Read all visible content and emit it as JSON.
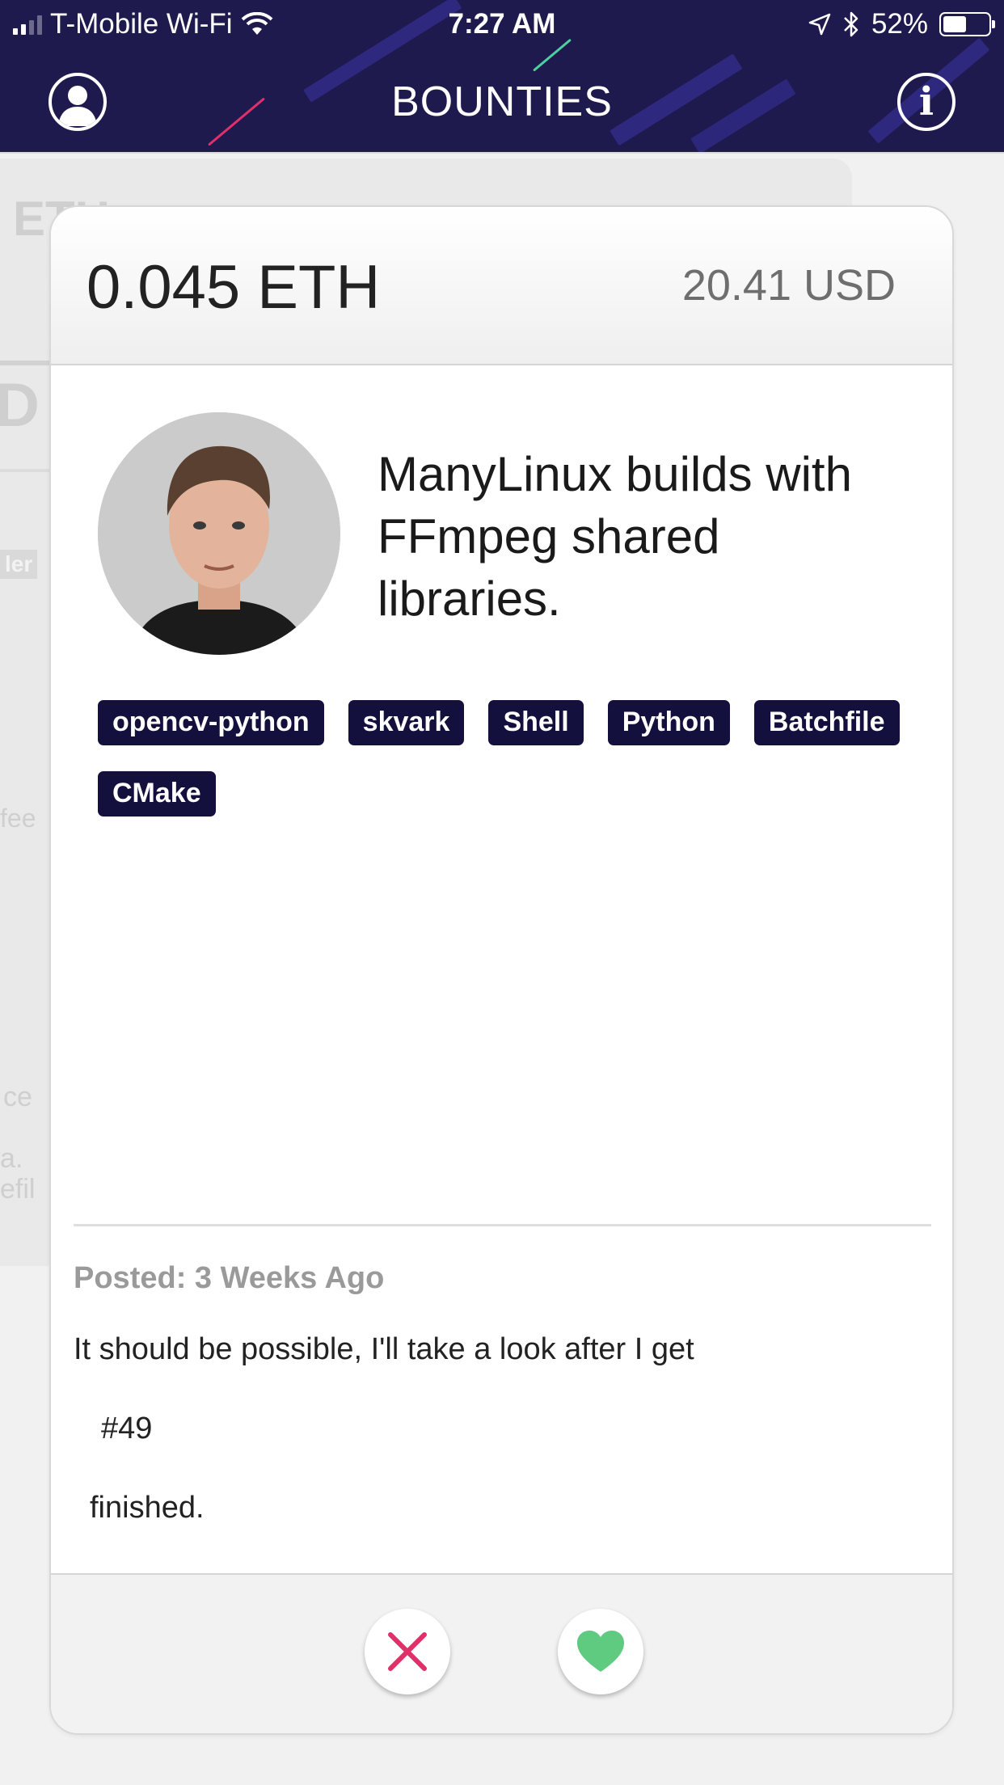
{
  "status_bar": {
    "carrier": "T-Mobile Wi-Fi",
    "time": "7:27 AM",
    "battery": "52%",
    "battery_level": 0.52
  },
  "header": {
    "title": "BOUNTIES",
    "info_label": "i"
  },
  "background_card": {
    "fragments": [
      "ETH",
      "D",
      "ler",
      "fee",
      "ce",
      "a. ",
      "efil"
    ]
  },
  "card": {
    "eth_amount": "0.045 ETH",
    "usd_amount": "20.41 USD",
    "title": "ManyLinux builds with FFmpeg shared libraries.",
    "title_lines": [
      "ManyLinux builds with",
      "FFmpeg shared",
      "libraries."
    ],
    "tags": [
      "opencv-python",
      "skvark",
      "Shell",
      "Python",
      "Batchfile",
      "CMake"
    ],
    "posted": "Posted: 3 Weeks Ago",
    "description_lines": [
      "It should be possible, I'll take a look after I get",
      "#49",
      "finished."
    ]
  },
  "colors": {
    "header_bg": "#1f1a4e",
    "tag_bg": "#13103d",
    "reject": "#e0306a",
    "like": "#5ecb80"
  },
  "icons": {
    "profile": "user-silhouette-icon",
    "info": "info-icon",
    "reject": "close-icon",
    "like": "heart-icon"
  }
}
